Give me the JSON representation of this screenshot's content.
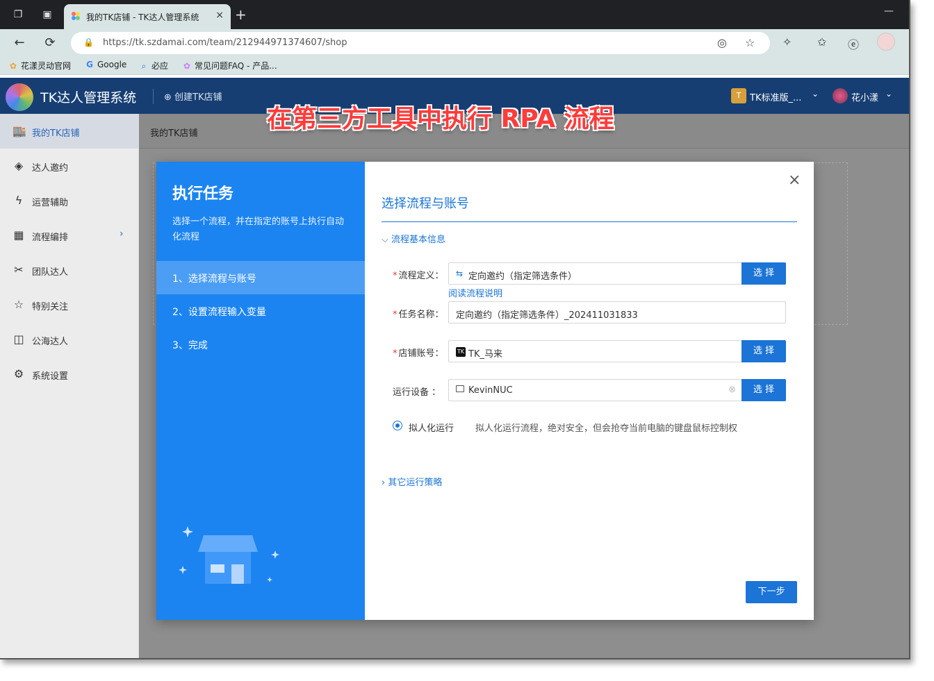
{
  "browser": {
    "tab_title": "我的TK店铺 - TK达人管理系统",
    "tab_close": "×",
    "new_tab": "+",
    "minimize": "—",
    "back": "←",
    "refresh": "⟳",
    "lock": "🔒",
    "url": "https://tk.szdamai.com/team/212944971374607/shop"
  },
  "bookmarks": [
    {
      "label": "花漾灵动官网"
    },
    {
      "label": "Google"
    },
    {
      "label": "必应"
    },
    {
      "label": "常见问题FAQ - 产品..."
    }
  ],
  "header": {
    "title": "TK达人管理系统",
    "create_shop": "⊕ 创建TK店铺",
    "plan_badge": "T",
    "plan": "TK标准版_...",
    "user": "花小漾",
    "chevron": "⌄"
  },
  "overlay_caption": "在第三方工具中执行 RPA 流程",
  "sidebar": {
    "items": [
      {
        "label": "我的TK店铺",
        "icon": "🏬"
      },
      {
        "label": "达人邀约",
        "icon": "◈"
      },
      {
        "label": "运营辅助",
        "icon": "ϟ"
      },
      {
        "label": "流程编排",
        "icon": "▦"
      },
      {
        "label": "团队达人",
        "icon": "✂"
      },
      {
        "label": "特别关注",
        "icon": "☆"
      },
      {
        "label": "公海达人",
        "icon": "◫"
      },
      {
        "label": "系统设置",
        "icon": "⚙"
      }
    ],
    "expand_chevron": "›"
  },
  "breadcrumb": "我的TK店铺",
  "modal": {
    "title": "执行任务",
    "description": "选择一个流程，并在指定的账号上执行自动化流程",
    "steps": [
      {
        "label": "1、选择流程与账号",
        "active": true
      },
      {
        "label": "2、设置流程输入变量",
        "active": false
      },
      {
        "label": "3、完成",
        "active": false
      }
    ],
    "close": "×",
    "section_title": "选择流程与账号",
    "basic_info_toggle": "⌵ 流程基本信息",
    "fields": {
      "flow_def": {
        "label": "流程定义：",
        "value": "定向邀约（指定筛选条件）",
        "button": "选 择",
        "icon": "⇆"
      },
      "read_link": "阅读流程说明",
      "task_name": {
        "label": "任务名称：",
        "value": "定向邀约（指定筛选条件）_202411031833"
      },
      "shop_account": {
        "label": "店铺账号：",
        "value": "TK_马来",
        "badge": "TK",
        "button": "选 择"
      },
      "device": {
        "label": "运行设备 ：",
        "value": "KevinNUC",
        "clear": "⊗",
        "button": "选 择"
      },
      "required_mark": "*"
    },
    "run_mode": {
      "label": "拟人化运行",
      "description": "拟人化运行流程，绝对安全，但会抢夺当前电脑的键盘鼠标控制权"
    },
    "other_strategy": "› 其它运行策略",
    "next_button": "下一步"
  },
  "colors": {
    "primary": "#1b74d6",
    "modal_left": "#1b84f0",
    "header_bg": "#163e73"
  }
}
